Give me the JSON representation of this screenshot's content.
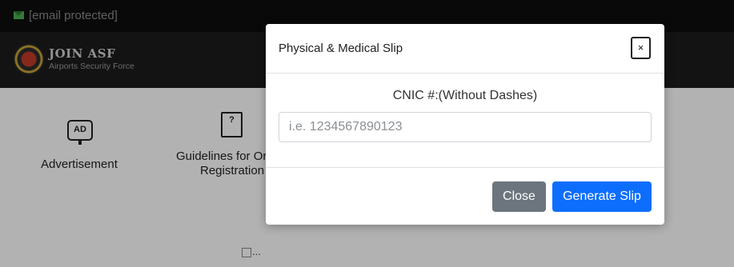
{
  "topbar": {
    "email": "[email protected]"
  },
  "brand": {
    "title": "JOIN ASF",
    "subtitle": "Airports Security Force"
  },
  "services": [
    {
      "label": "Advertisement",
      "icon": "ad-monitor-icon",
      "icon_text": "AD"
    },
    {
      "label_line1": "Guidelines for Or",
      "label_line2": "Registration",
      "icon": "guidelines-document-icon",
      "icon_text": "?"
    }
  ],
  "broken_image": {
    "alt": "..."
  },
  "modal": {
    "title": "Physical & Medical Slip",
    "close_icon": "×",
    "cnic_label": "CNIC #:(Without Dashes)",
    "cnic_placeholder": "i.e. 1234567890123",
    "cnic_value": "",
    "close_button": "Close",
    "generate_button": "Generate Slip"
  },
  "colors": {
    "primary": "#0d6efd",
    "secondary": "#6c757d",
    "topbar": "#0d0d0d",
    "brandbar": "#1c1c1c"
  }
}
